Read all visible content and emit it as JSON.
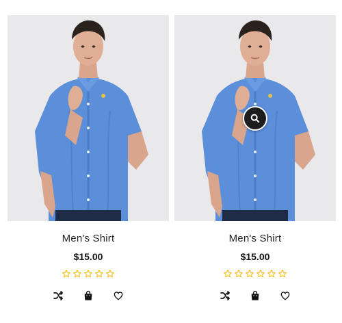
{
  "accent_colors": {
    "star_outline": "#f2b705",
    "shirt_blue": "#5b8fd9",
    "photo_background": "#e9e9eb",
    "icon_dark": "#1d1d1d"
  },
  "products": [
    {
      "name": "Men's Shirt",
      "price": "$15.00",
      "rating": 0,
      "rating_max": 5,
      "image_icon": "product-photo",
      "show_quick_view": false,
      "actions": [
        "compare-shuffle-icon",
        "add-to-cart-bag-icon",
        "wishlist-heart-icon"
      ]
    },
    {
      "name": "Men's Shirt",
      "price": "$15.00",
      "rating": 0,
      "rating_max": 5,
      "image_icon": "product-photo",
      "show_quick_view": true,
      "quick_view_icon": "magnifier-icon",
      "actions": [
        "compare-shuffle-icon",
        "add-to-cart-bag-icon",
        "wishlist-heart-icon"
      ]
    }
  ]
}
